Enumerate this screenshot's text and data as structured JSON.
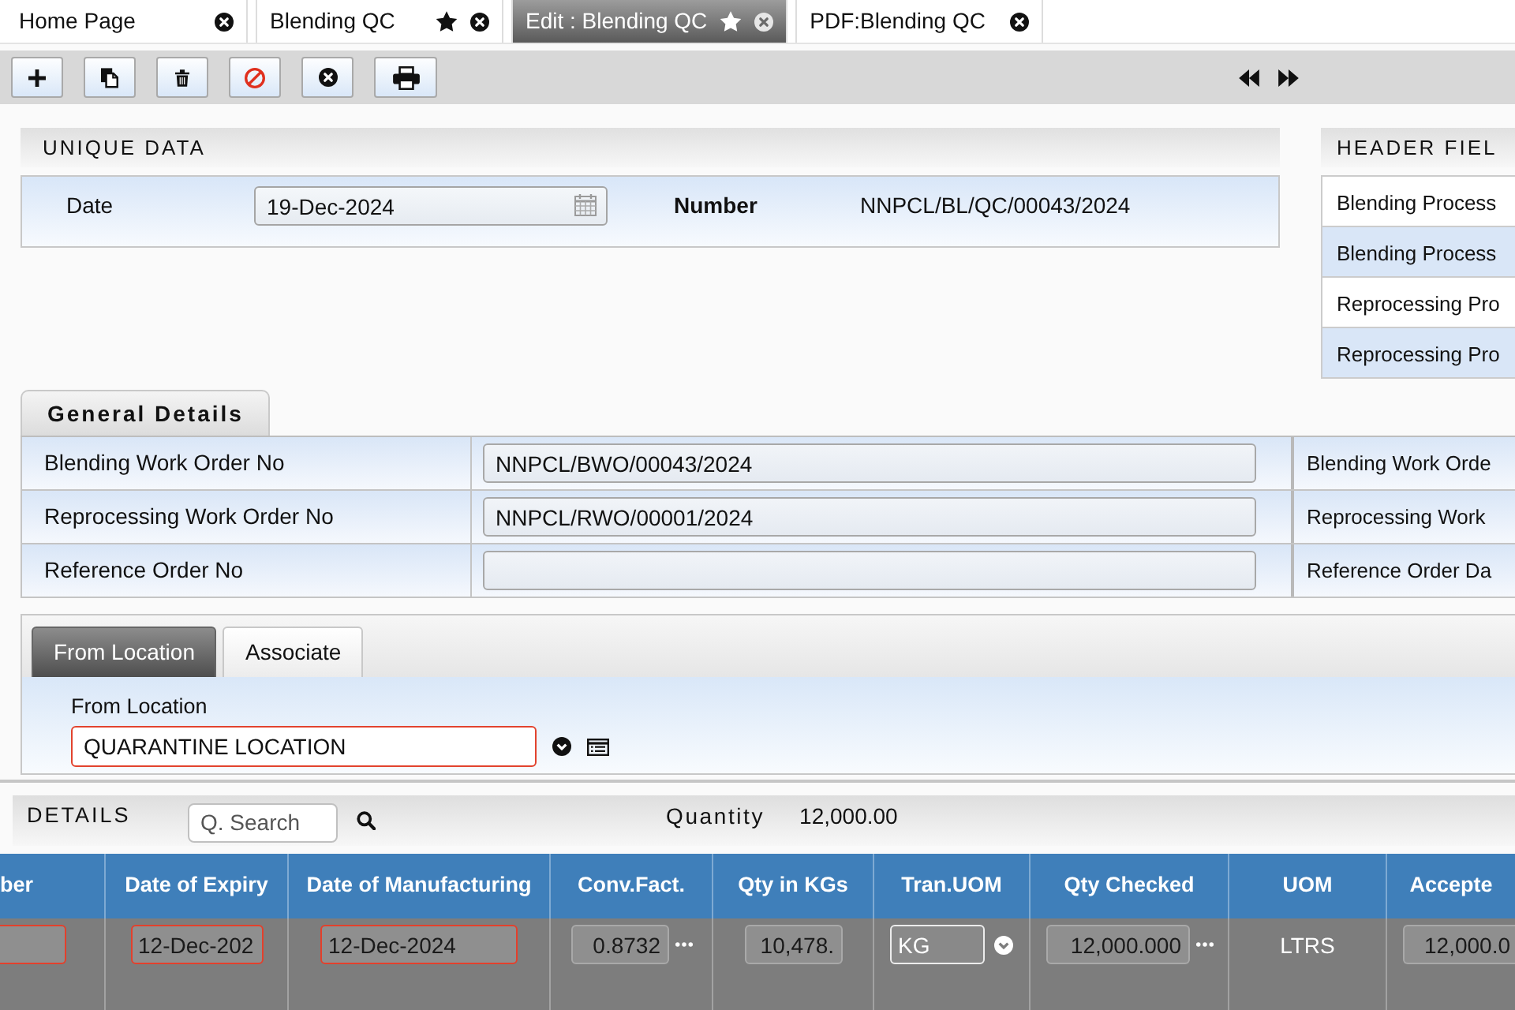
{
  "tabs": [
    {
      "label": "Home Page",
      "selected": false,
      "starred": false
    },
    {
      "label": "Blending QC",
      "selected": false,
      "starred": true
    },
    {
      "label": "Edit : Blending QC",
      "selected": true,
      "starred": true
    },
    {
      "label": "PDF:Blending QC",
      "selected": false,
      "starred": false
    }
  ],
  "toolbar": {
    "buttons": [
      {
        "kind": "add"
      },
      {
        "kind": "copy"
      },
      {
        "kind": "delete"
      },
      {
        "kind": "cancel"
      },
      {
        "kind": "close"
      },
      {
        "kind": "print"
      }
    ],
    "navigation": [
      {
        "kind": "previous"
      },
      {
        "kind": "next"
      }
    ]
  },
  "unique_data": {
    "title": "UNIQUE DATA",
    "fields": [
      {
        "kind": "date",
        "label": "Date",
        "value": "19-Dec-2024"
      },
      {
        "kind": "text",
        "label": "Number",
        "value": "NNPCL/BL/QC/00043/2024"
      }
    ]
  },
  "header_fields": {
    "title": "HEADER FIEL",
    "items": [
      "Blending Process",
      "Blending Process",
      "Reprocessing Pro",
      "Reprocessing Pro"
    ]
  },
  "general_details": {
    "title": "General Details",
    "rows": [
      {
        "label": "Blending Work Order No",
        "value": "NNPCL/BWO/00043/2024",
        "next_label": "Blending Work Orde"
      },
      {
        "label": "Reprocessing Work Order No",
        "value": "NNPCL/RWO/00001/2024",
        "next_label": "Reprocessing Work"
      },
      {
        "label": "Reference Order No",
        "next_label": "Reference Order Da"
      }
    ]
  },
  "location": {
    "tabs": [
      {
        "label": "From Location",
        "selected": true
      },
      {
        "label": "Associate",
        "selected": false
      }
    ],
    "field": {
      "label": "From Location",
      "value": "QUARANTINE LOCATION",
      "required": true
    }
  },
  "details": {
    "title": "DETAILS",
    "search": {
      "placeholder": "Q. Search"
    },
    "quantity_label": "Quantity",
    "quantity": "12,000.00",
    "columns": [
      "ber",
      "Date of Expiry",
      "Date of Manufacturing",
      "Conv.Fact.",
      "Qty in KGs",
      "Tran.UOM",
      "Qty Checked",
      "UOM",
      "Accepte"
    ],
    "rows": [
      {
        "cells": [
          {
            "kind": "input",
            "required": true,
            "lookup": false
          },
          {
            "kind": "input",
            "value": "12-Dec-202",
            "required": true,
            "lookup": false
          },
          {
            "kind": "input",
            "value": "12-Dec-2024",
            "required": true,
            "lookup": false
          },
          {
            "kind": "number",
            "value": "0.8732",
            "required": false,
            "lookup": true
          },
          {
            "kind": "number",
            "value": "10,478.",
            "required": false,
            "lookup": false
          },
          {
            "kind": "select",
            "value": "KG"
          },
          {
            "kind": "number",
            "value": "12,000.000",
            "required": false,
            "lookup": true
          },
          {
            "kind": "text",
            "value": "LTRS"
          },
          {
            "kind": "number",
            "value": "12,000.0",
            "required": false,
            "lookup": false
          }
        ]
      }
    ]
  }
}
